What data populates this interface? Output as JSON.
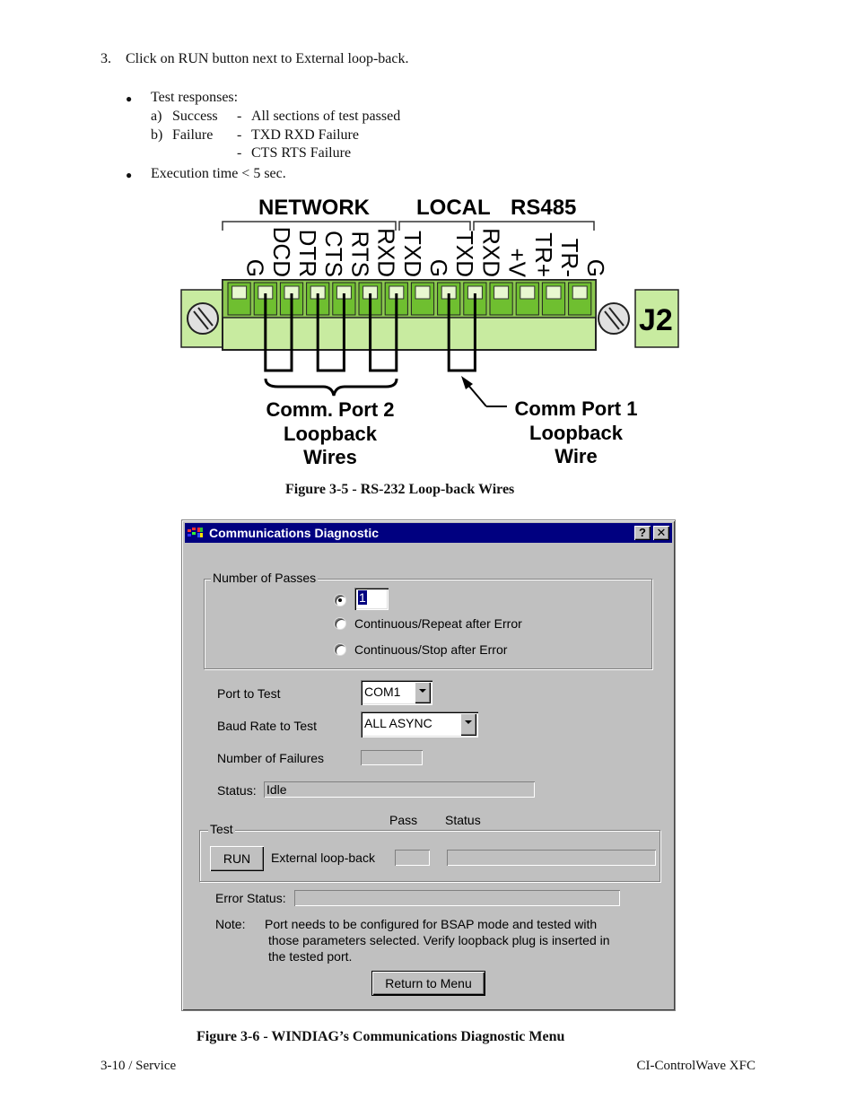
{
  "instructions": {
    "step_number": "3.",
    "step_text": "Click on RUN button next to External loop-back.",
    "bullets": [
      {
        "label": "Test responses:",
        "responses": [
          {
            "letter": "a)",
            "result": "Success",
            "dash": "-",
            "detail": "All sections of test passed"
          },
          {
            "letter": "b)",
            "result": "Failure",
            "dash": "-",
            "detail": "TXD RXD Failure"
          },
          {
            "letter": "",
            "result": "",
            "dash": "-",
            "detail": "CTS RTS Failure"
          }
        ]
      },
      {
        "label": "Execution time < 5 sec."
      }
    ]
  },
  "figure1": {
    "groups": [
      "NETWORK",
      "LOCAL",
      "RS485"
    ],
    "pins": [
      "G",
      "DCD",
      "DTR",
      "CTS",
      "RTS",
      "RXD",
      "TXD",
      "G",
      "TXD",
      "RXD",
      "+V",
      "TR+",
      "TR-",
      "G"
    ],
    "connector_label": "J2",
    "callout_port2": [
      "Comm. Port 2",
      "Loopback",
      "Wires"
    ],
    "callout_port1": [
      "Comm Port 1",
      "Loopback",
      "Wire"
    ],
    "caption": "Figure 3-5 - RS-232 Loop-back Wires"
  },
  "dialog": {
    "title": "Communications Diagnostic",
    "help_button": "?",
    "close_button": "✕",
    "passes_group": {
      "label": "Number of Passes",
      "count_value": "1",
      "options": [
        "Continuous/Repeat after Error",
        "Continuous/Stop after  Error"
      ]
    },
    "port_label": "Port to Test",
    "port_value": "COM1",
    "baud_label": "Baud Rate to Test",
    "baud_value": "ALL ASYNC",
    "failures_label": "Number of Failures",
    "failures_value": "",
    "status_label": "Status:",
    "status_value": "Idle",
    "test_group": {
      "label": "Test",
      "pass_header": "Pass",
      "status_header": "Status",
      "run_button": "RUN",
      "test_name": "External loop-back",
      "pass_value": "",
      "status_value": ""
    },
    "error_status_label": "Error Status:",
    "error_status_value": "",
    "note_label": "Note:",
    "note_lines": [
      "Port needs to be configured for BSAP mode and tested with",
      "those parameters selected. Verify loopback plug is inserted in",
      "the tested port."
    ],
    "return_button": "Return to Menu"
  },
  "figure2_caption": "Figure 3-6 - WINDIAG’s Communications Diagnostic Menu",
  "footer": {
    "left": "3-10 / Service",
    "right": "CI-ControlWave XFC"
  },
  "colors": {
    "titlebar": "#000080",
    "dialog_face": "#c0c0c0",
    "connector_green": "#c8eba0",
    "connector_dark_green": "#7cc040"
  }
}
